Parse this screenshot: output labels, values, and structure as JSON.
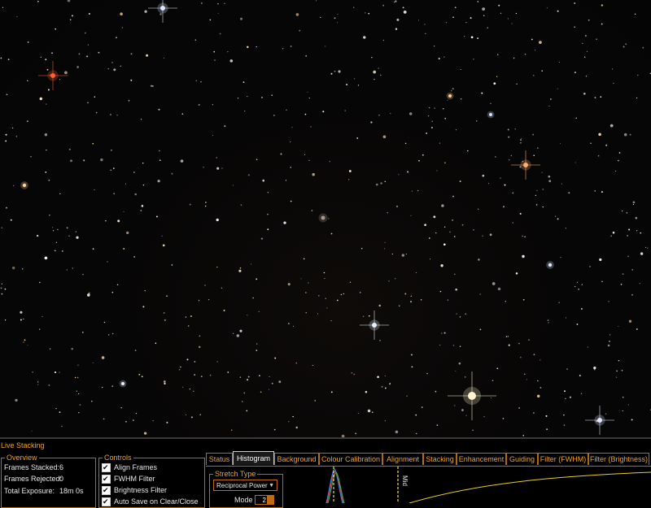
{
  "panel": {
    "title": "Live Stacking"
  },
  "overview": {
    "title": "Overview",
    "frames_stacked_label": "Frames Stacked:",
    "frames_stacked_value": "6",
    "frames_rejected_label": "Frames Rejected:",
    "frames_rejected_value": "0",
    "total_exposure_label": "Total Exposure:",
    "total_exposure_value": "18m 0s"
  },
  "controls": {
    "title": "Controls",
    "items": [
      {
        "label": "Align Frames",
        "checked": true
      },
      {
        "label": "FWHM Filter",
        "checked": true
      },
      {
        "label": "Brightness Filter",
        "checked": true
      },
      {
        "label": "Auto Save on Clear/Close",
        "checked": true
      }
    ]
  },
  "tabs": [
    {
      "label": "Status",
      "active": false
    },
    {
      "label": "Histogram",
      "active": true
    },
    {
      "label": "Background",
      "active": false
    },
    {
      "label": "Colour Calibration",
      "active": false
    },
    {
      "label": "Alignment",
      "active": false
    },
    {
      "label": "Stacking",
      "active": false
    },
    {
      "label": "Enhancement",
      "active": false
    },
    {
      "label": "Guiding",
      "active": false
    },
    {
      "label": "Filter (FWHM)",
      "active": false
    },
    {
      "label": "Filter (Brightness)",
      "active": false
    }
  ],
  "histogram": {
    "stretch_type_title": "Stretch Type",
    "stretch_type_value": "Reciprocal Power",
    "mode_label": "Mode",
    "mode_value": "2",
    "mid_label": "Mid"
  },
  "colors": {
    "accent": "#f0a020",
    "border": "#b06a10",
    "curve": "#e8d020"
  }
}
